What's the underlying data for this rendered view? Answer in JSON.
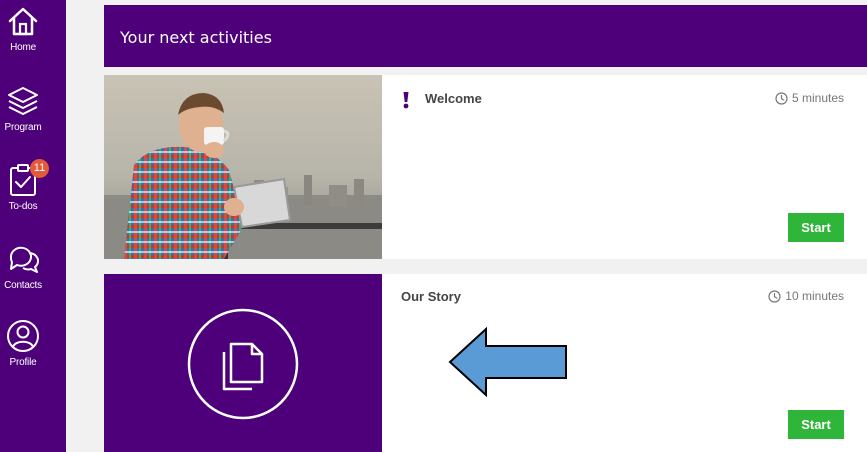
{
  "sidebar": {
    "items": [
      {
        "label": "Home",
        "icon": "home-icon"
      },
      {
        "label": "Program",
        "icon": "layers-icon"
      },
      {
        "label": "To-dos",
        "icon": "clipboard-check-icon",
        "badge": "11"
      },
      {
        "label": "Contacts",
        "icon": "chat-bubbles-icon"
      },
      {
        "label": "Profile",
        "icon": "user-circle-icon"
      }
    ]
  },
  "header": {
    "title": "Your next activities"
  },
  "activities": [
    {
      "title": "Welcome",
      "duration": "5 minutes",
      "button": "Start",
      "icon": "exclamation-icon"
    },
    {
      "title": "Our Story",
      "duration": "10 minutes",
      "button": "Start",
      "icon": "document-copy-icon"
    }
  ],
  "colors": {
    "brand": "#4d0079",
    "start_button": "#2fb53a",
    "badge": "#e35a3c",
    "arrow": "#5b9bd5"
  }
}
